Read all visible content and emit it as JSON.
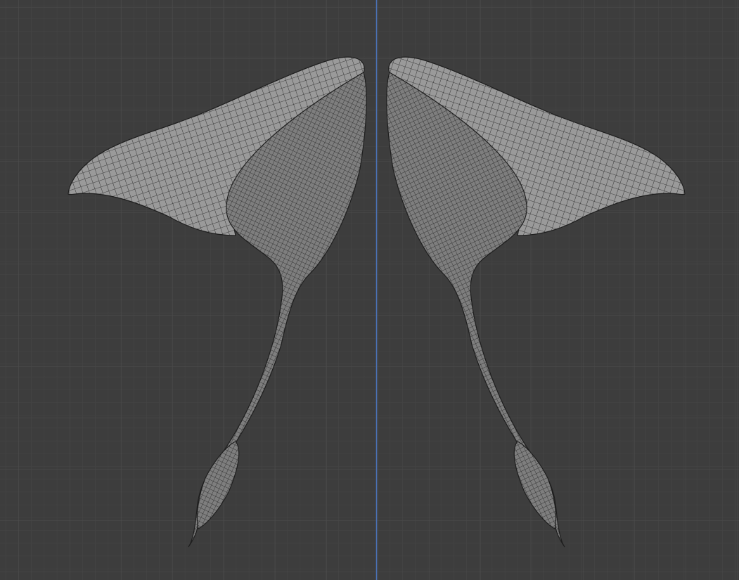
{
  "viewport": {
    "background_color": "#3d3d3d",
    "grid_minor_color": "#454545",
    "grid_major_color": "#4d4d4d",
    "axis_color": "#4a72b6",
    "mesh_fill_color": "#9a9a9a",
    "mesh_shadow_color": "#7e7e7e",
    "mesh_wire_color": "#1e1e1e",
    "grid_visible": true,
    "mirrored_object": true
  }
}
